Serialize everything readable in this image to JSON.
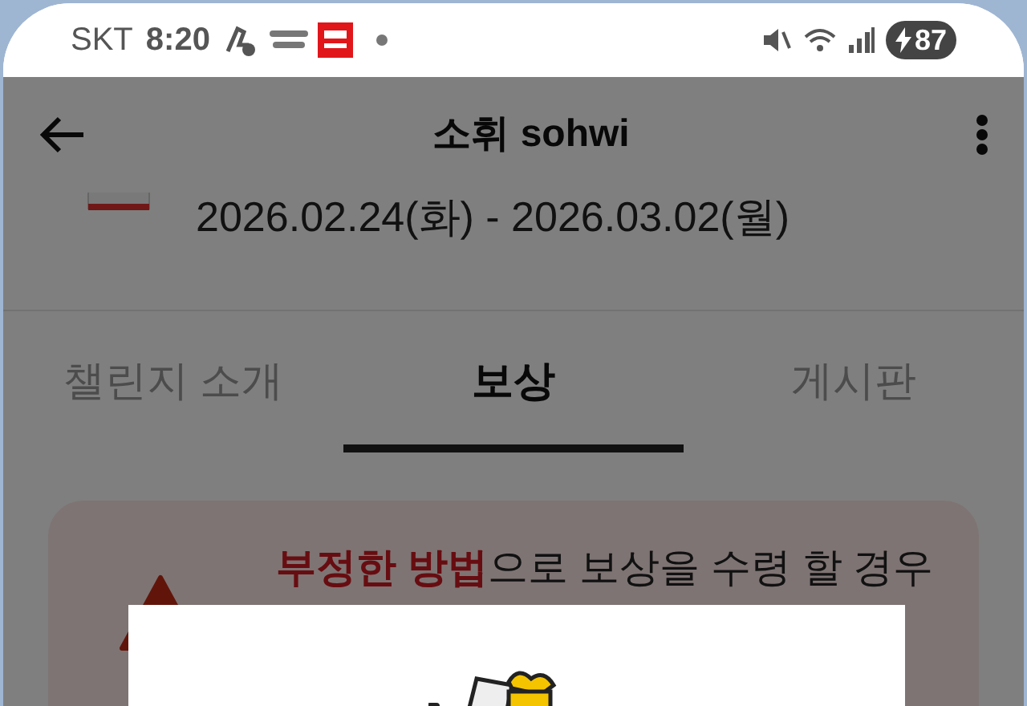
{
  "status_bar": {
    "carrier": "SKT",
    "time": "8:20",
    "battery": "87"
  },
  "header": {
    "title": "소휘 sohwi"
  },
  "period": "2026.02.24(화) - 2026.03.02(월)",
  "tabs": [
    {
      "label": "챌린지 소개",
      "selected": false
    },
    {
      "label": "보상",
      "selected": true
    },
    {
      "label": "게시판",
      "selected": false
    }
  ],
  "warning": {
    "text": "**부정한 방법**으로 보상을 수령 할 경우"
  }
}
